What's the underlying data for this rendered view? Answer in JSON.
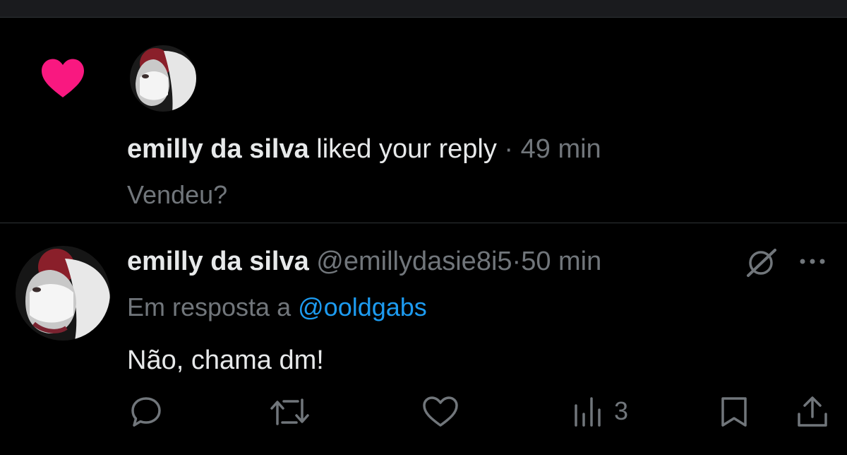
{
  "notification": {
    "user_name": "emilly da silva",
    "action_text": "liked your reply",
    "separator": "·",
    "time": "49 min",
    "reply_text": "Vendeu?",
    "icon": "heart-icon",
    "heart_color": "#f91880"
  },
  "tweet": {
    "user_name": "emilly da silva",
    "handle": "@emillydasie8i5",
    "separator": "·",
    "time": "50 min",
    "reply_prefix": "Em resposta a",
    "reply_mention": "@ooldgabs",
    "text": "Não, chama dm!",
    "mention_color": "#1d9bf0",
    "actions": {
      "reply_icon": "comment-icon",
      "retweet_icon": "retweet-icon",
      "like_icon": "heart-outline-icon",
      "views_icon": "views-chart-icon",
      "views_count": "3",
      "bookmark_icon": "bookmark-icon",
      "share_icon": "share-icon"
    }
  },
  "colors": {
    "background": "#000000",
    "text": "#e7e9ea",
    "muted": "#71767b",
    "divider": "#2f3336"
  }
}
